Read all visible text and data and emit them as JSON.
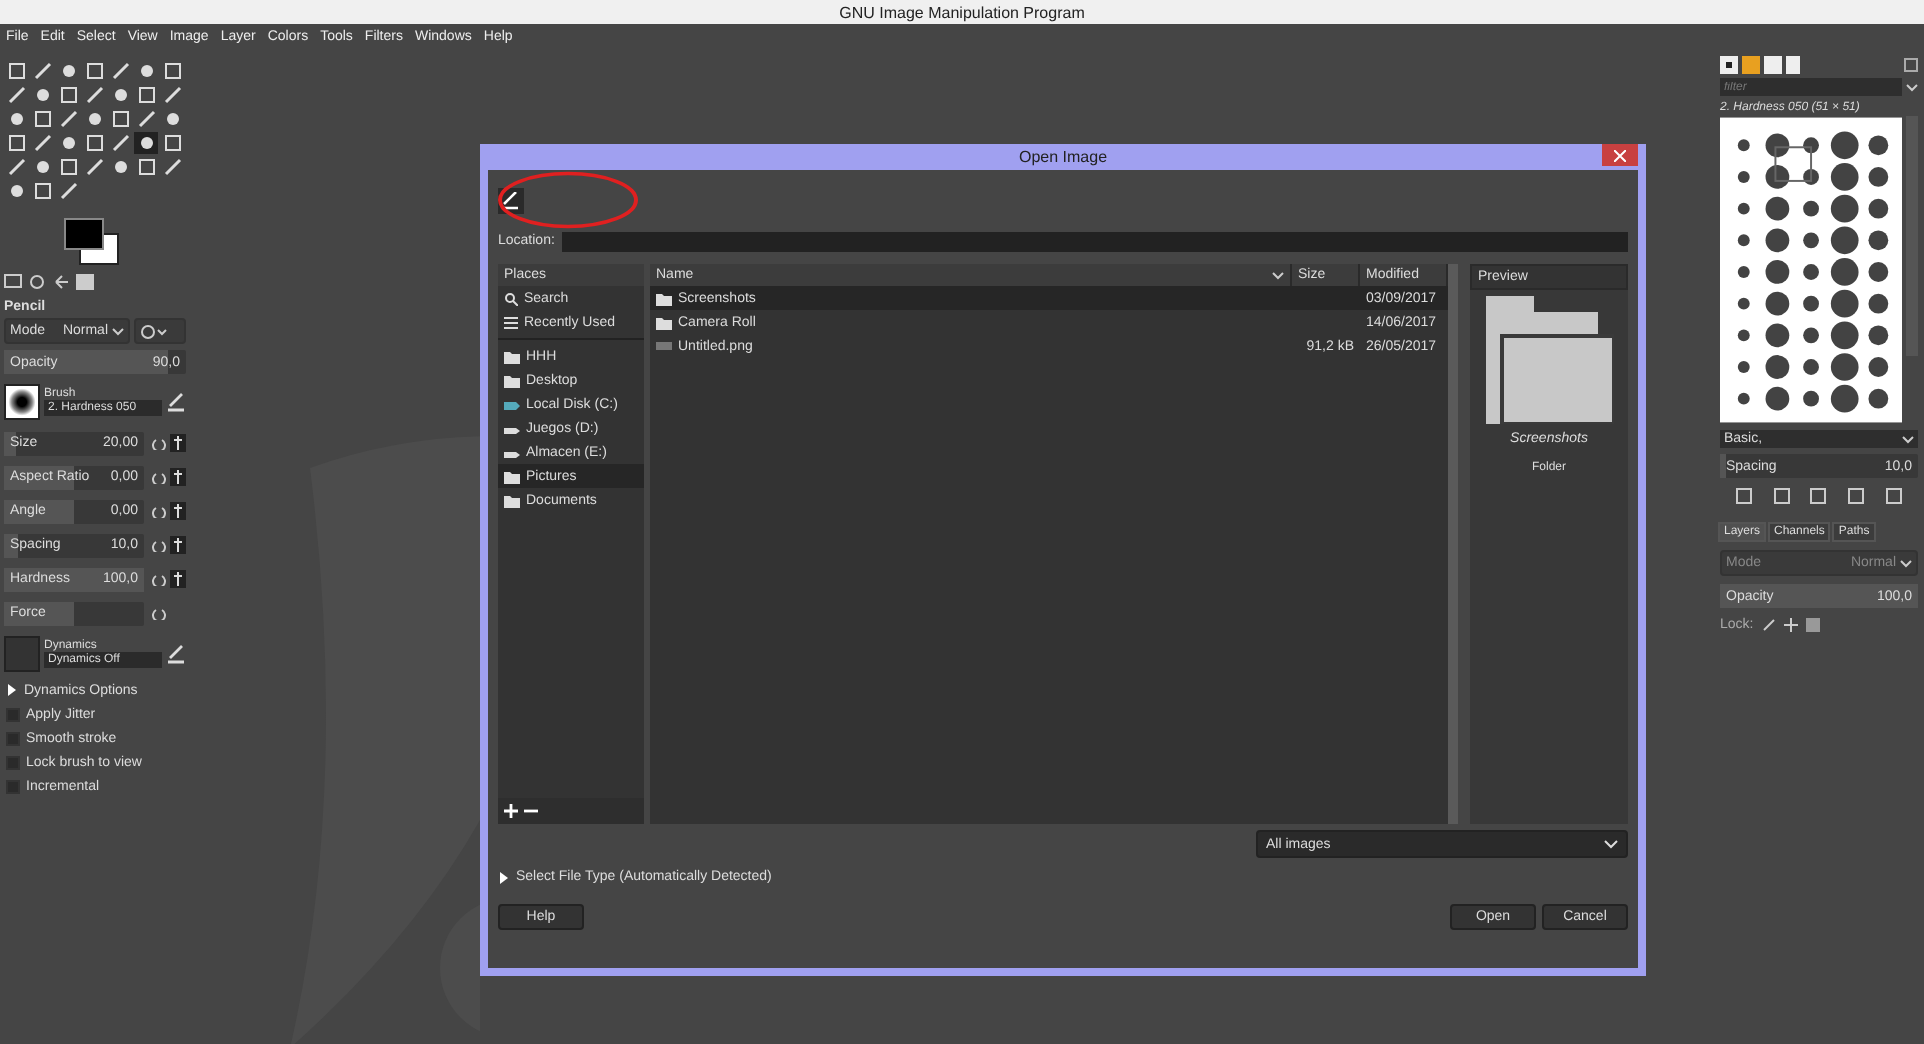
{
  "window": {
    "title": "GNU Image Manipulation Program"
  },
  "menu": [
    "File",
    "Edit",
    "Select",
    "View",
    "Image",
    "Layer",
    "Colors",
    "Tools",
    "Filters",
    "Windows",
    "Help"
  ],
  "toolbox": {
    "tools": [
      {
        "selected": false
      },
      {
        "selected": false
      },
      {
        "selected": false
      },
      {
        "selected": false
      },
      {
        "selected": false
      },
      {
        "selected": false
      },
      {
        "selected": false
      },
      {
        "selected": false
      },
      {
        "selected": false
      },
      {
        "selected": false
      },
      {
        "selected": false
      },
      {
        "selected": false
      },
      {
        "selected": false
      },
      {
        "selected": false
      },
      {
        "selected": false
      },
      {
        "selected": false
      },
      {
        "selected": false
      },
      {
        "selected": false
      },
      {
        "selected": false
      },
      {
        "selected": false
      },
      {
        "selected": false
      },
      {
        "selected": false
      },
      {
        "selected": false
      },
      {
        "selected": false
      },
      {
        "selected": false
      },
      {
        "selected": false
      },
      {
        "selected": true
      },
      {
        "selected": false
      },
      {
        "selected": false
      },
      {
        "selected": false
      },
      {
        "selected": false
      },
      {
        "selected": false
      },
      {
        "selected": false
      },
      {
        "selected": false
      },
      {
        "selected": false
      },
      {
        "selected": false
      },
      {
        "selected": false
      },
      {
        "selected": false
      }
    ],
    "title": "Pencil",
    "mode": {
      "label": "Mode",
      "value": "Normal"
    },
    "opacity": {
      "label": "Opacity",
      "value": "90,0",
      "level": 0.9
    },
    "brush": {
      "label": "Brush",
      "value": "2. Hardness 050"
    },
    "sliders": [
      {
        "label": "Size",
        "value": "20,00",
        "level": 0.08,
        "linked": true
      },
      {
        "label": "Aspect Ratio",
        "value": "0,00",
        "level": 0.5,
        "linked": true
      },
      {
        "label": "Angle",
        "value": "0,00",
        "level": 0.5,
        "linked": true
      },
      {
        "label": "Spacing",
        "value": "10,0",
        "level": 0.1,
        "linked": true
      },
      {
        "label": "Hardness",
        "value": "100,0",
        "level": 1,
        "linked": true
      },
      {
        "label": "Force",
        "level": 0.5,
        "linked": false
      }
    ],
    "dynamics": {
      "label": "Dynamics",
      "value": "Dynamics Off"
    },
    "options": [
      {
        "kind": "expander",
        "label": "Dynamics Options",
        "expanded": false
      },
      {
        "kind": "checkbox",
        "label": "Apply Jitter",
        "checked": false
      },
      {
        "kind": "checkbox",
        "label": "Smooth stroke",
        "checked": false
      },
      {
        "kind": "checkbox",
        "label": "Lock brush to view",
        "checked": false
      },
      {
        "kind": "checkbox",
        "label": "Incremental",
        "checked": false
      }
    ]
  },
  "dialog": {
    "title": "Open Image",
    "location": {
      "label": "Location:"
    },
    "places": {
      "header": "Places",
      "items": [
        {
          "kind": "search",
          "label": "Search",
          "selected": false,
          "section_end": false
        },
        {
          "kind": "recent",
          "label": "Recently Used",
          "selected": false,
          "section_end": true
        },
        {
          "kind": "folder",
          "label": "HHH",
          "selected": false,
          "section_end": false
        },
        {
          "kind": "folder",
          "label": "Desktop",
          "selected": false,
          "section_end": false
        },
        {
          "kind": "system-drive",
          "label": "Local Disk (C:)",
          "selected": false,
          "section_end": false
        },
        {
          "kind": "drive",
          "label": "Juegos (D:)",
          "selected": false,
          "section_end": false
        },
        {
          "kind": "drive",
          "label": "Almacen (E:)",
          "selected": false,
          "section_end": false
        },
        {
          "kind": "folder",
          "label": "Pictures",
          "selected": true,
          "section_end": false
        },
        {
          "kind": "folder",
          "label": "Documents",
          "selected": false,
          "section_end": false
        }
      ]
    },
    "columns": [
      "Name",
      "Size",
      "Modified"
    ],
    "files": [
      {
        "kind": "folder",
        "name": "Screenshots",
        "modified": "03/09/2017",
        "selected": true
      },
      {
        "kind": "folder",
        "name": "Camera Roll",
        "modified": "14/06/2017",
        "selected": false
      },
      {
        "kind": "image",
        "name": "Untitled.png",
        "size": "91,2 kB",
        "modified": "26/05/2017",
        "selected": false
      }
    ],
    "preview": {
      "title": "Preview",
      "name": "Screenshots",
      "type": "Folder"
    },
    "filter": "All images",
    "file_type": {
      "label": "Select File Type (Automatically Detected)",
      "expanded": false
    },
    "buttons": [
      {
        "label": "Help"
      },
      {
        "label": "Open"
      },
      {
        "label": "Cancel"
      }
    ]
  },
  "dock": {
    "filter_placeholder": "filter",
    "brush_title": "2. Hardness 050 (51 × 51)",
    "tag": "Basic,",
    "spacing": {
      "label": "Spacing",
      "value": "10,0",
      "level": 0.03
    },
    "tabs": [
      {
        "label": "Layers",
        "selected": true
      },
      {
        "label": "Channels",
        "selected": false
      },
      {
        "label": "Paths",
        "selected": false
      }
    ],
    "mode": {
      "label": "Mode",
      "value": "Normal"
    },
    "opacity": {
      "label": "Opacity",
      "value": "100,0",
      "level": 1
    },
    "lock_label": "Lock:"
  }
}
